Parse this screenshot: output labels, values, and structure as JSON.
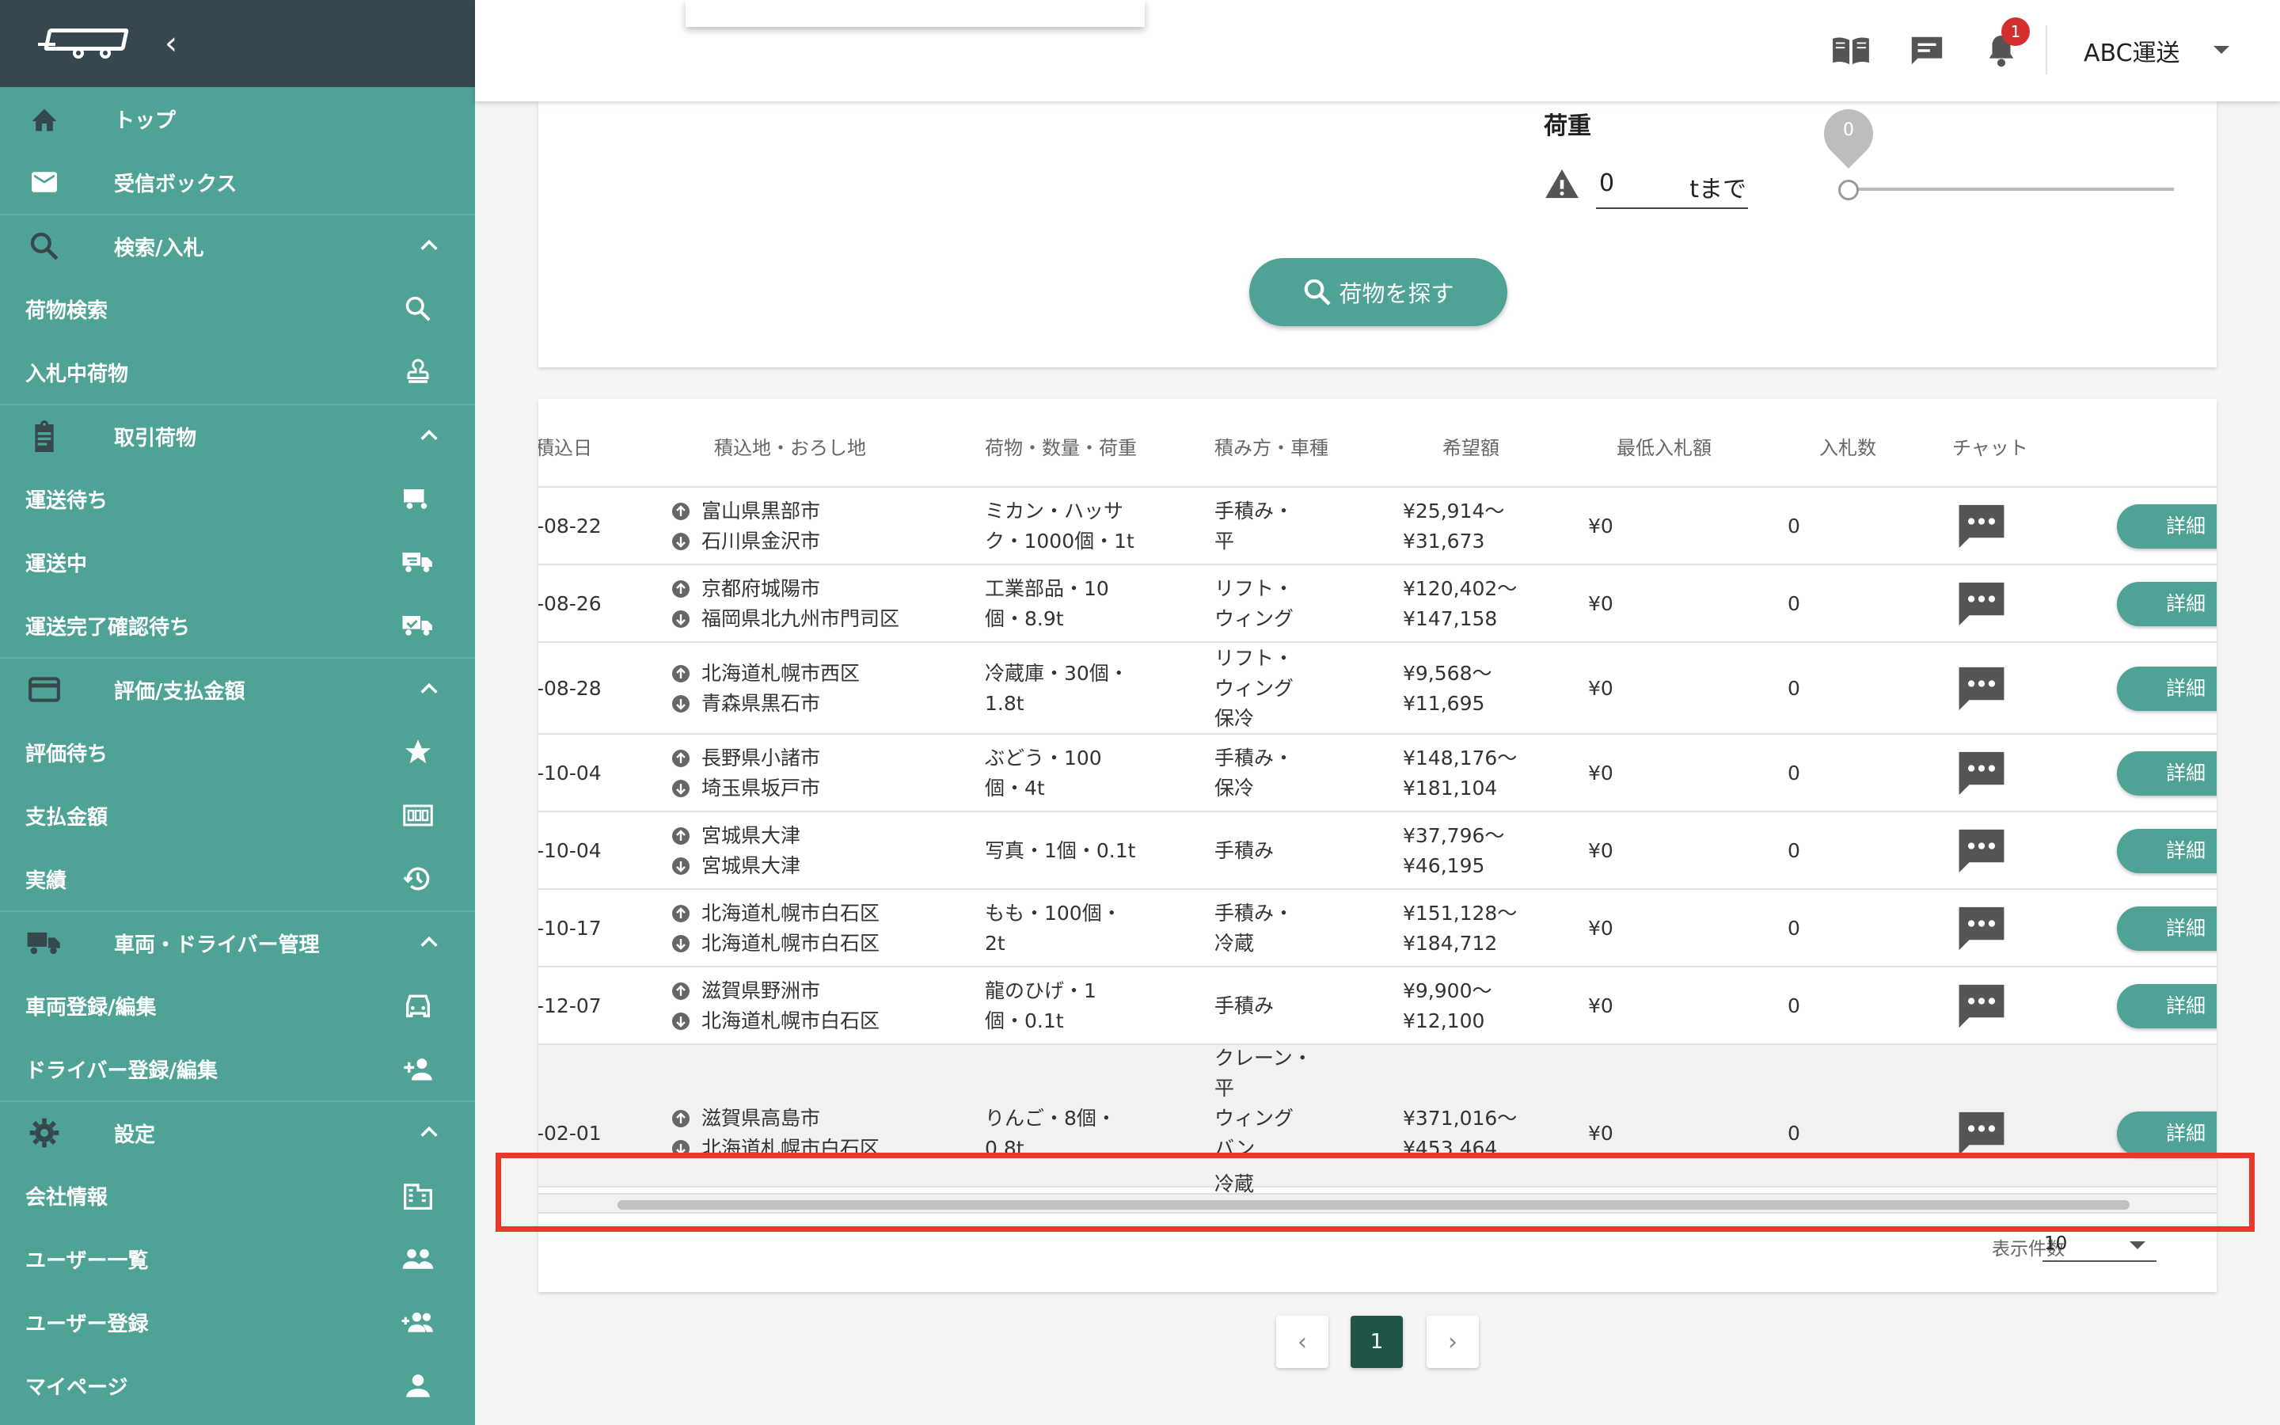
{
  "sidebar": {
    "top": "トップ",
    "inbox": "受信ボックス",
    "search_group": "検索/入札",
    "cargo_search": "荷物検索",
    "bidding_cargo": "入札中荷物",
    "deals_group": "取引荷物",
    "awaiting_transport": "運送待ち",
    "in_transport": "運送中",
    "awaiting_confirmation": "運送完了確認待ち",
    "eval_group": "評価/支払金額",
    "awaiting_eval": "評価待ち",
    "payment_amount": "支払金額",
    "results": "実績",
    "vehicle_group": "車両・ドライバー管理",
    "vehicle_register": "車両登録/編集",
    "driver_register": "ドライバー登録/編集",
    "settings_group": "設定",
    "company_info": "会社情報",
    "user_list": "ユーザー一覧",
    "user_register": "ユーザー登録",
    "my_page": "マイページ"
  },
  "header": {
    "notification_count": "1",
    "company": "ABC運送"
  },
  "search": {
    "weight_label": "荷重",
    "weight_value": "0",
    "weight_unit": "tまで",
    "slider_value": "0",
    "button_label": "荷物を探す"
  },
  "table": {
    "headers": {
      "load_date": "積込日",
      "locations": "積込地・おろし地",
      "cargo": "荷物・数量・荷重",
      "loading": "積み方・車種",
      "desired": "希望額",
      "min_bid": "最低入札額",
      "bid_count": "入札数",
      "chat": "チャット"
    },
    "detail_label": "詳細",
    "rows": [
      {
        "date": "-08-22",
        "from": "富山県黒部市",
        "to": "石川県金沢市",
        "cargo": [
          "ミカン・ハッサ",
          "ク・1000個・1t"
        ],
        "loading": [
          "手積み・",
          "平"
        ],
        "desired": [
          "¥25,914〜",
          "¥31,673"
        ],
        "min_bid": "¥0",
        "bids": "0"
      },
      {
        "date": "-08-26",
        "from": "京都府城陽市",
        "to": "福岡県北九州市門司区",
        "cargo": [
          "工業部品・10",
          "個・8.9t"
        ],
        "loading": [
          "リフト・",
          "ウィング"
        ],
        "desired": [
          "¥120,402〜",
          "¥147,158"
        ],
        "min_bid": "¥0",
        "bids": "0"
      },
      {
        "date": "-08-28",
        "from": "北海道札幌市西区",
        "to": "青森県黒石市",
        "cargo": [
          "冷蔵庫・30個・",
          "1.8t"
        ],
        "loading": [
          "リフト・",
          "ウィング",
          "保冷"
        ],
        "desired": [
          "¥9,568〜",
          "¥11,695"
        ],
        "min_bid": "¥0",
        "bids": "0"
      },
      {
        "date": "-10-04",
        "from": "長野県小諸市",
        "to": "埼玉県坂戸市",
        "cargo": [
          "ぶどう・100",
          "個・4t"
        ],
        "loading": [
          "手積み・",
          "保冷"
        ],
        "desired": [
          "¥148,176〜",
          "¥181,104"
        ],
        "min_bid": "¥0",
        "bids": "0"
      },
      {
        "date": "-10-04",
        "from": "宮城県大津",
        "to": "宮城県大津",
        "cargo": [
          "写真・1個・0.1t"
        ],
        "loading": [
          "手積み"
        ],
        "desired": [
          "¥37,796〜",
          "¥46,195"
        ],
        "min_bid": "¥0",
        "bids": "0"
      },
      {
        "date": "-10-17",
        "from": "北海道札幌市白石区",
        "to": "北海道札幌市白石区",
        "cargo": [
          "もも・100個・",
          "2t"
        ],
        "loading": [
          "手積み・",
          "冷蔵"
        ],
        "desired": [
          "¥151,128〜",
          "¥184,712"
        ],
        "min_bid": "¥0",
        "bids": "0"
      },
      {
        "date": "-12-07",
        "from": "滋賀県野洲市",
        "to": "北海道札幌市白石区",
        "cargo": [
          "龍のひげ・1",
          "個・0.1t"
        ],
        "loading": [
          "手積み"
        ],
        "desired": [
          "¥9,900〜",
          "¥12,100"
        ],
        "min_bid": "¥0",
        "bids": "0"
      },
      {
        "date": "-02-01",
        "from": "滋賀県高島市",
        "to": "北海道札幌市白石区",
        "cargo": [
          "りんご・8個・",
          "0.8t"
        ],
        "loading": [
          "クレーン・",
          "平",
          "ウィング",
          "バン"
        ],
        "desired": [
          "¥371,016〜",
          "¥453,464"
        ],
        "min_bid": "¥0",
        "bids": "0"
      }
    ],
    "overflow_text": "冷蔵",
    "per_page_label": "表示件数",
    "per_page_value": "10"
  },
  "pagination": {
    "current": "1"
  },
  "colors": {
    "sidebar": "#4fa396",
    "sidebar_header": "#37474f",
    "accent": "#4fa396",
    "active_page": "#1f5446",
    "badge": "#d32f2f",
    "highlight": "#e8392b"
  }
}
